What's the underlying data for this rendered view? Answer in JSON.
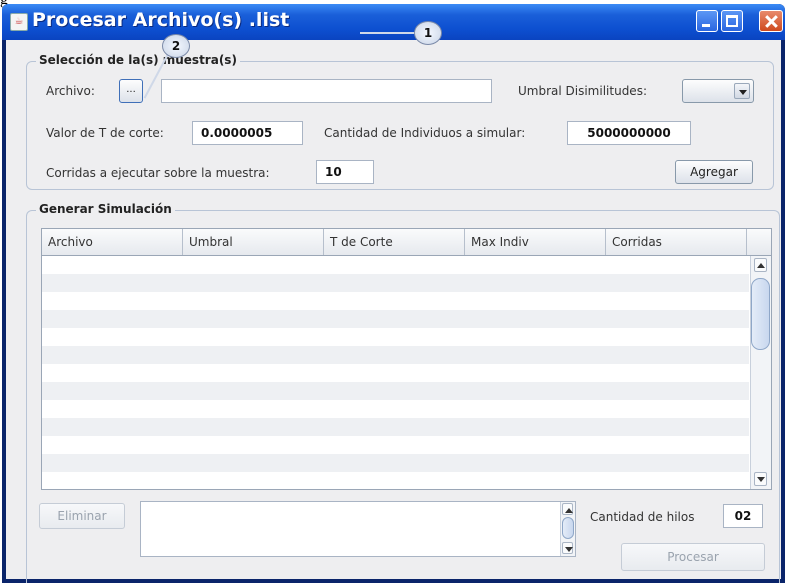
{
  "window": {
    "title": "Procesar Archivo(s) .list"
  },
  "callouts": [
    "1",
    "2"
  ],
  "sample_selection": {
    "legend": "Selección de la(s) muestra(s)",
    "archivo_label": "Archivo:",
    "browse_button_label": "...",
    "archivo_value": "",
    "umbral_label": "Umbral Disimilitudes:",
    "umbral_selected": "",
    "t_corte_label": "Valor de T de corte:",
    "t_corte_value": "0.0000005",
    "individuos_label": "Cantidad de Individuos a simular:",
    "individuos_value": "5000000000",
    "corridas_label": "Corridas a ejecutar sobre la muestra:",
    "corridas_value": "10",
    "add_button_label": "Agregar"
  },
  "simulation": {
    "legend": "Generar Simulación",
    "columns": [
      "Archivo",
      "Umbral",
      "T de Corte",
      "Max Indiv",
      "Corridas"
    ],
    "rows": [],
    "remove_button_label": "Eliminar",
    "threads_label": "Cantidad de hilos",
    "threads_value": "02",
    "process_button_label": "Procesar"
  }
}
